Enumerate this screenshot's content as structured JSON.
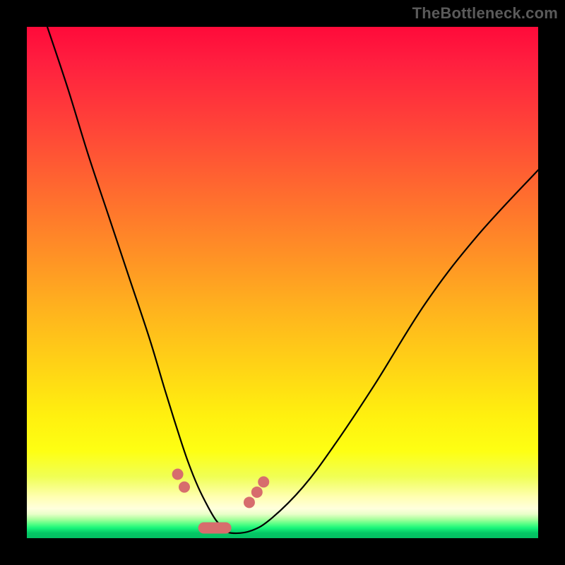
{
  "watermark": "TheBottleneck.com",
  "colors": {
    "frame": "#000000",
    "curve": "#000000",
    "marker": "#d76d6d"
  },
  "chart_data": {
    "type": "line",
    "title": "",
    "xlabel": "",
    "ylabel": "",
    "xlim": [
      0,
      100
    ],
    "ylim": [
      0,
      100
    ],
    "grid": false,
    "legend": false,
    "note": "Axes unlabeled; values estimated from image coordinates (x,y in 0–100 range, y-up).",
    "series": [
      {
        "name": "curve",
        "x": [
          4,
          8,
          12,
          16,
          20,
          24,
          27,
          29.5,
          31.5,
          33.5,
          35.5,
          37,
          38.5,
          40,
          44,
          48,
          54,
          60,
          68,
          78,
          88,
          100
        ],
        "y": [
          100,
          88,
          75,
          63,
          51,
          39,
          29,
          21,
          15,
          10,
          6,
          3.5,
          2,
          1,
          1.5,
          4,
          10,
          18,
          30,
          46,
          59,
          72
        ]
      }
    ],
    "markers": [
      {
        "name": "left-upper-dot",
        "x": 29.5,
        "y": 12.5
      },
      {
        "name": "left-mid-dot",
        "x": 30.8,
        "y": 10.0
      },
      {
        "name": "trough-blob",
        "shape": "oblong",
        "x_range": [
          33.5,
          40.0
        ],
        "y": 2.0
      },
      {
        "name": "right-lower-dot",
        "x": 43.5,
        "y": 7.0
      },
      {
        "name": "right-mid-dot",
        "x": 45.0,
        "y": 9.0
      },
      {
        "name": "right-upper-dot",
        "x": 46.3,
        "y": 11.0
      }
    ],
    "background_gradient": {
      "direction": "top-to-bottom",
      "stops": [
        {
          "pos": 0.0,
          "color": "#ff0a3a"
        },
        {
          "pos": 0.32,
          "color": "#ff6a2f"
        },
        {
          "pos": 0.66,
          "color": "#ffd216"
        },
        {
          "pos": 0.83,
          "color": "#feff13"
        },
        {
          "pos": 0.94,
          "color": "#ffffdd"
        },
        {
          "pos": 1.0,
          "color": "#04c063"
        }
      ]
    }
  }
}
